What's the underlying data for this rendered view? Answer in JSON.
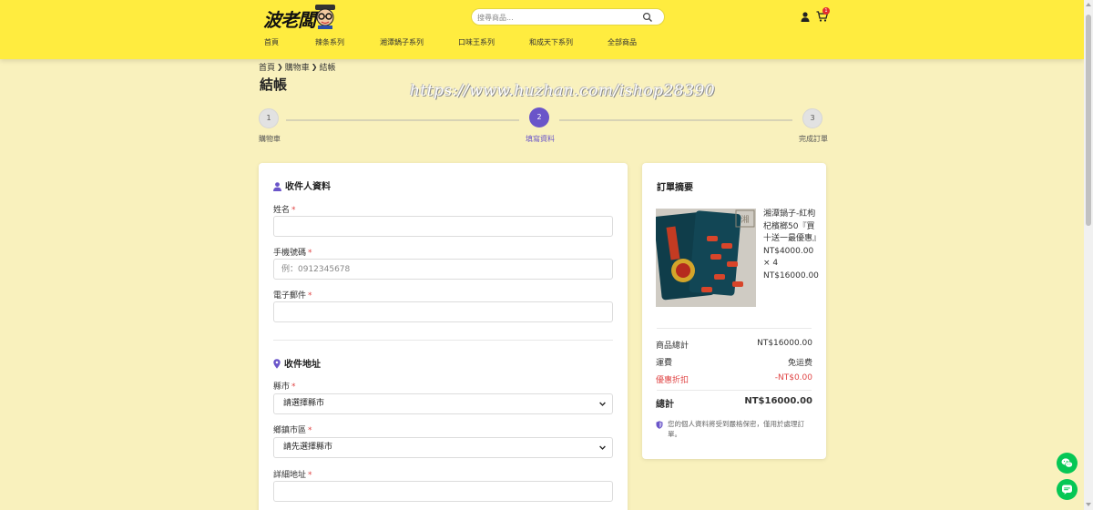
{
  "header": {
    "logo_text": "波老闆",
    "search": {
      "placeholder": "搜尋商品..."
    },
    "cart_count": "1",
    "nav": [
      {
        "label": "首頁"
      },
      {
        "label": "辣条系列"
      },
      {
        "label": "湘潭鍋子系列"
      },
      {
        "label": "口味王系列"
      },
      {
        "label": "和成天下系列"
      },
      {
        "label": "全部商品"
      }
    ]
  },
  "breadcrumb": {
    "home": "首頁",
    "cart": "購物車",
    "current": "結帳"
  },
  "page_title": "結帳",
  "watermark": "https://www.huzhan.com/ishop28390",
  "stepper": [
    {
      "number": "1",
      "label": "購物車",
      "state": "inactive"
    },
    {
      "number": "2",
      "label": "填寫資料",
      "state": "active"
    },
    {
      "number": "3",
      "label": "完成訂單",
      "state": "inactive"
    }
  ],
  "recipient": {
    "title": "收件人資料",
    "name_label": "姓名",
    "name_value": "",
    "phone_label": "手機號碼",
    "phone_placeholder": "例：0912345678",
    "email_label": "電子郵件",
    "email_value": "",
    "required_mark": "*"
  },
  "address": {
    "title": "收件地址",
    "city_label": "縣市",
    "city_value": "請選擇縣市",
    "district_label": "鄉鎮市區",
    "district_value": "請先選擇縣市",
    "detail_label": "詳細地址",
    "detail_value": ""
  },
  "summary": {
    "title": "訂單摘要",
    "item": {
      "name": "湘潭鍋子-紅枸杞檳榔50『買十送一最優惠』",
      "price": "NT$4000.00",
      "qty": "× 4",
      "subtotal": "NT$16000.00"
    },
    "rows": {
      "goods_total_label": "商品總計",
      "goods_total_value": "NT$16000.00",
      "shipping_label": "運費",
      "shipping_value": "免运费",
      "discount_label": "優惠折扣",
      "discount_value": "-NT$0.00",
      "total_label": "總計",
      "total_value": "NT$16000.00"
    },
    "privacy_note": "您的個人資料將受到嚴格保密，僅用於處理訂單。"
  },
  "colors": {
    "header_bg": "#ffec3f",
    "page_bg": "#f9f1bd",
    "accent": "#6a55c9",
    "discount": "#e04545",
    "float_button": "#06c755"
  },
  "icons": [
    "search-icon",
    "user-icon",
    "cart-icon",
    "person-icon",
    "location-pin-icon",
    "chevron-down-icon",
    "shield-icon",
    "wechat-icon",
    "line-icon"
  ]
}
